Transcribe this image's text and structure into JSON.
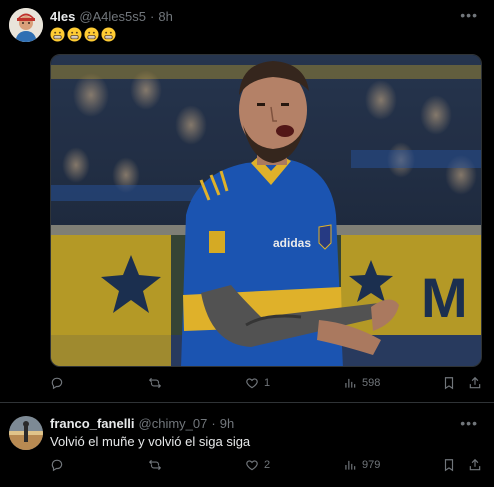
{
  "tweets": [
    {
      "author": {
        "name": "4les",
        "handle": "@A4les5s5"
      },
      "separator": "·",
      "time": "8h",
      "emojis": [
        "grimace-emoji",
        "grimace-emoji",
        "grimace-emoji",
        "grimace-emoji"
      ],
      "has_media": true,
      "stats": {
        "replies": "",
        "retweets": "",
        "likes": "1",
        "views": "598"
      }
    },
    {
      "author": {
        "name": "franco_fanelli",
        "handle": "@chimy_07"
      },
      "separator": "·",
      "time": "9h",
      "text": "Volvió el muñe y volvió el siga siga",
      "stats": {
        "replies": "",
        "retweets": "",
        "likes": "2",
        "views": "979"
      }
    }
  ],
  "colors": {
    "background": "#000000",
    "text_primary": "#e7e9ea",
    "text_secondary": "#71767b",
    "divider": "#2f3336"
  },
  "icons": {
    "reply": "reply-icon",
    "retweet": "retweet-icon",
    "like": "heart-icon",
    "views": "views-icon",
    "bookmark": "bookmark-icon",
    "share": "share-icon",
    "more": "more-icon"
  }
}
